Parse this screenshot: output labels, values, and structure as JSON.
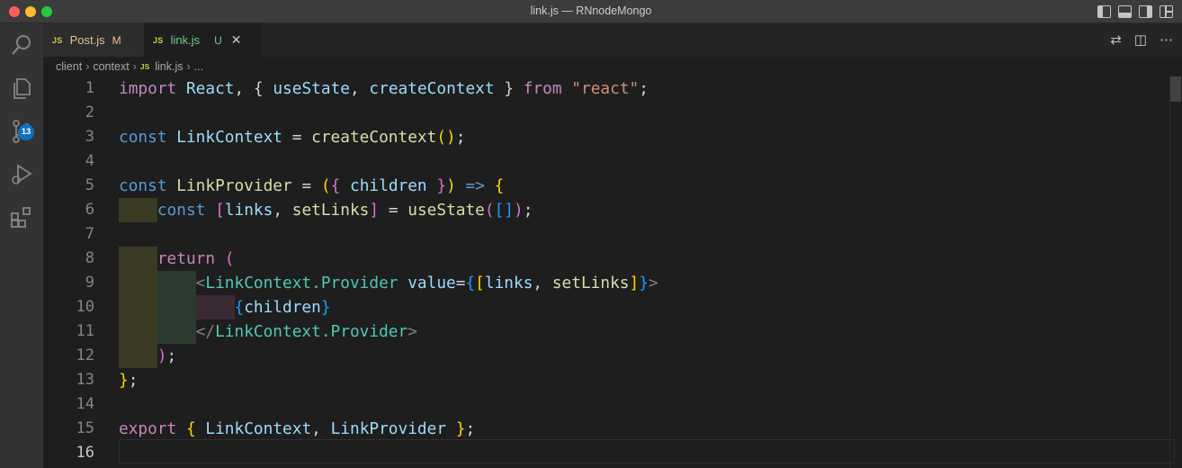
{
  "window": {
    "title": "link.js — RNnodeMongo"
  },
  "activity_bar": {
    "items": [
      {
        "icon": "explorer-search-icon"
      },
      {
        "icon": "files-icon"
      },
      {
        "icon": "source-control-icon",
        "badge": "13"
      },
      {
        "icon": "run-debug-icon"
      },
      {
        "icon": "extensions-icon"
      }
    ]
  },
  "tabs": [
    {
      "lang": "JS",
      "name": "Post.js",
      "status": "M"
    },
    {
      "lang": "JS",
      "name": "link.js",
      "status": "U",
      "close": "✕"
    }
  ],
  "breadcrumbs": {
    "parts": [
      "client",
      "context"
    ],
    "lang": "JS",
    "file": "link.js",
    "more": "..."
  },
  "editor": {
    "line_numbers": [
      "1",
      "2",
      "3",
      "4",
      "5",
      "6",
      "7",
      "8",
      "9",
      "10",
      "11",
      "12",
      "13",
      "14",
      "15",
      "16"
    ],
    "active_line": "16",
    "lines": {
      "l1": {
        "t1": "import",
        "t2": "React",
        "t3": "{",
        "t4": "useState",
        "t5": "createContext",
        "t6": "}",
        "t7": "from",
        "t8": "\"react\""
      },
      "l3": {
        "t1": "const",
        "t2": "LinkContext",
        "t3": "createContext"
      },
      "l5": {
        "t1": "const",
        "t2": "LinkProvider",
        "t3": "(",
        "t4": "{",
        "t5": "children",
        "t6": "}",
        "t7": ")",
        "t8": "=>",
        "t9": "{"
      },
      "l6": {
        "t1": "const",
        "t2": "[",
        "t3": "links",
        "t4": "setLinks",
        "t5": "]",
        "t6": "useState",
        "t7": "("
      },
      "l8": {
        "t1": "return",
        "t2": "("
      },
      "l9": {
        "t1": "<",
        "t2": "LinkContext.Provider",
        "t3": "value",
        "t4": "{",
        "t5": "[",
        "t6": "links",
        "t7": "setLinks",
        "t8": "]",
        "t9": "}",
        "t10": ">"
      },
      "l10": {
        "t1": "{",
        "t2": "children",
        "t3": "}"
      },
      "l11": {
        "t1": "</",
        "t2": "LinkContext.Provider",
        "t3": ">"
      },
      "l12": {
        "t1": ")"
      },
      "l13": {
        "t1": "}"
      },
      "l15": {
        "t1": "export",
        "t2": "LinkContext",
        "t3": "LinkProvider"
      }
    }
  },
  "colors": {
    "keyword_control": "#c586c0",
    "keyword_storage": "#569cd6",
    "variable": "#9cdcfe",
    "function": "#dcdcaa",
    "string": "#ce9178",
    "jsx_tag": "#4ec9b0",
    "bracket_gold": "#ffd700",
    "bracket_orchid": "#da70d6",
    "bracket_blue": "#179fff",
    "badge_blue": "#0e70c0"
  }
}
